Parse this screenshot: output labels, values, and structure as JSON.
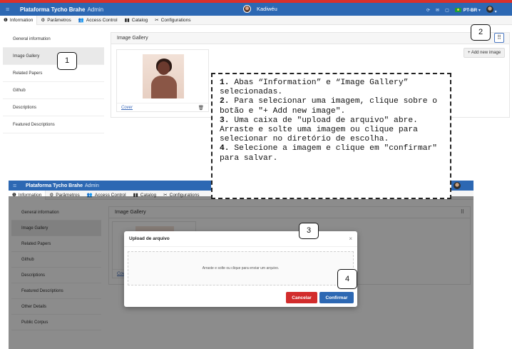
{
  "app": {
    "brand": "Plataforma Tycho Brahe",
    "brand_sub": "Admin",
    "corpus_name": "Kadiwéu",
    "language": "PT-BR"
  },
  "tabs": [
    {
      "label": "Information",
      "icon": "info-icon"
    },
    {
      "label": "Parâmetros",
      "icon": "cogs-icon"
    },
    {
      "label": "Access Control",
      "icon": "users-icon"
    },
    {
      "label": "Catalog",
      "icon": "book-icon"
    },
    {
      "label": "Configurations",
      "icon": "tools-icon"
    }
  ],
  "sidebar1": {
    "items": [
      "General information",
      "Image Gallery",
      "Related Papers",
      "Github",
      "Descriptions",
      "Featured Descriptions"
    ]
  },
  "sidebar2": {
    "items": [
      "General information",
      "Image Gallery",
      "Related Papers",
      "Github",
      "Descriptions",
      "Featured Descriptions",
      "Other Details",
      "Public Corpus"
    ]
  },
  "gallery": {
    "title": "Image Gallery",
    "add_button": "+ Add new image",
    "cover_label": "Cover",
    "cover_label_partial": "Cov"
  },
  "callouts": {
    "c1": "1",
    "c2": "2",
    "c3": "3",
    "c4": "4"
  },
  "instructions": {
    "s1_num": "1.",
    "s1_text": " Abas “Information” e “Image Gallery” selecionadas.",
    "s2_num": "2.",
    "s2_text": " Para selecionar uma imagem, clique sobre o botão e \"+ Add new image\".",
    "s3_num": "3.",
    "s3_text": " Uma caixa de \"upload de arquivo\" abre. Arraste e solte uma imagem ou clique para selecionar no diretório de escolha.",
    "s4_num": "4.",
    "s4_text": " Selecione a imagem e clique em \"confirmar\" para salvar."
  },
  "modal": {
    "title": "Upload de arquivo",
    "dropzone_text": "Arraste e solte ou clique para enviar um arquivo.",
    "cancel_label": "Cancelar",
    "confirm_label": "Confirmar"
  },
  "colors": {
    "navbar": "#2d68b3",
    "topbar": "#d9302b",
    "cancel": "#d22c2c",
    "confirm": "#2d68b3"
  }
}
